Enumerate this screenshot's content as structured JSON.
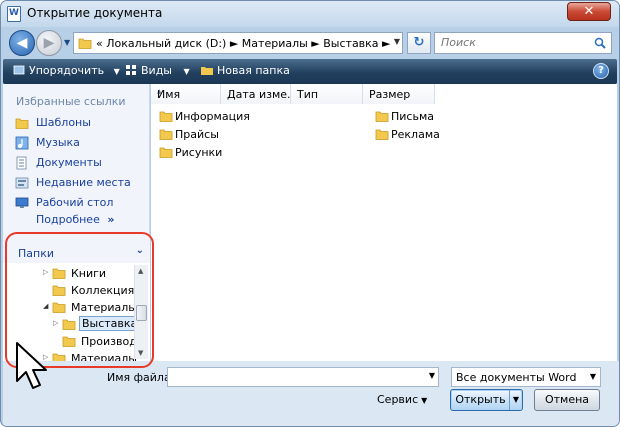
{
  "window": {
    "title": "Открытие документа",
    "close_label": "✕"
  },
  "address": {
    "prefix": "«",
    "crumbs": [
      "Локальный диск (D:)",
      "Материалы",
      "Выставка"
    ],
    "separator": "►",
    "path_display": "«  Локальный диск (D:)  ►  Материалы  ►  Выставка  ►"
  },
  "search": {
    "placeholder": "Поиск"
  },
  "toolbar": {
    "organize_label": "Упорядочить",
    "views_label": "Виды",
    "new_folder_label": "Новая папка",
    "help_label": "?"
  },
  "favorites": {
    "header": "Избранные ссылки",
    "items": [
      {
        "label": "Шаблоны",
        "icon": "folder-icon"
      },
      {
        "label": "Музыка",
        "icon": "music-icon"
      },
      {
        "label": "Документы",
        "icon": "documents-icon"
      },
      {
        "label": "Недавние места",
        "icon": "recent-places-icon"
      },
      {
        "label": "Рабочий стол",
        "icon": "desktop-icon"
      }
    ],
    "more_label": "Подробнее",
    "more_suffix": "»"
  },
  "folders_tree": {
    "header": "Папки",
    "items": [
      {
        "label": "Книги",
        "state": "collapsed",
        "selected": false
      },
      {
        "label": "Коллекция",
        "state": "none",
        "selected": false
      },
      {
        "label": "Материалы",
        "state": "expanded",
        "selected": false
      },
      {
        "label": "Выставка",
        "state": "collapsed",
        "selected": true
      },
      {
        "label": "Производ",
        "state": "none",
        "selected": false
      },
      {
        "label": "Материалы",
        "state": "collapsed",
        "selected": false
      }
    ]
  },
  "columns": [
    "Имя",
    "Дата изме...",
    "Тип",
    "Размер"
  ],
  "files": {
    "left": [
      "Информация",
      "Прайсы",
      "Рисунки"
    ],
    "right": [
      "Письма",
      "Реклама"
    ]
  },
  "bottom": {
    "filename_label": "Имя файла:",
    "filename_value": "",
    "filetype_value": "Все документы Word",
    "service_label": "Сервис",
    "open_label": "Открыть",
    "cancel_label": "Отмена"
  },
  "colors": {
    "annotation_frame": "#e83a2a",
    "toolbar_bg": "#22405f",
    "link_text": "#1a3f9c",
    "folder_yellow": "#f2c94c"
  }
}
